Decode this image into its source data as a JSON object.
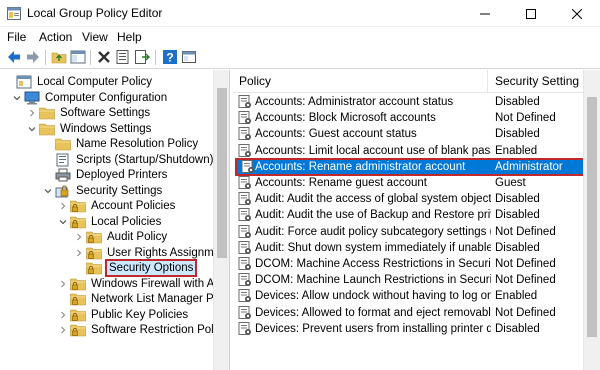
{
  "window": {
    "title": "Local Group Policy Editor"
  },
  "menu": [
    "File",
    "Action",
    "View",
    "Help"
  ],
  "toolbar_icons": [
    "back-arrow-icon",
    "forward-arrow-icon",
    "up-folder-icon",
    "show-hide-tree-icon",
    "delete-icon",
    "properties-icon",
    "export-list-icon",
    "help-icon",
    "console-icon"
  ],
  "tree": [
    {
      "label": "Local Computer Policy",
      "icon": "computer-policy-icon",
      "expander": ""
    },
    {
      "label": "Computer Configuration",
      "icon": "computer-icon",
      "expander": "down"
    },
    {
      "label": "Software Settings",
      "icon": "folder-icon",
      "expander": "right"
    },
    {
      "label": "Windows Settings",
      "icon": "folder-icon",
      "expander": "down"
    },
    {
      "label": "Name Resolution Policy",
      "icon": "folder-icon",
      "expander": ""
    },
    {
      "label": "Scripts (Startup/Shutdown)",
      "icon": "scripts-icon",
      "expander": ""
    },
    {
      "label": "Deployed Printers",
      "icon": "printer-icon",
      "expander": ""
    },
    {
      "label": "Security Settings",
      "icon": "security-settings-icon",
      "expander": "down"
    },
    {
      "label": "Account Policies",
      "icon": "folder-lock-icon",
      "expander": "right"
    },
    {
      "label": "Local Policies",
      "icon": "folder-lock-icon",
      "expander": "down"
    },
    {
      "label": "Audit Policy",
      "icon": "folder-lock-icon",
      "expander": "right"
    },
    {
      "label": "User Rights Assignment",
      "icon": "folder-lock-icon",
      "expander": "right"
    },
    {
      "label": "Security Options",
      "icon": "folder-lock-icon",
      "expander": ""
    },
    {
      "label": "Windows Firewall with Adva",
      "icon": "folder-lock-icon",
      "expander": "right"
    },
    {
      "label": "Network List Manager Polici",
      "icon": "folder-lock-icon",
      "expander": ""
    },
    {
      "label": "Public Key Policies",
      "icon": "folder-lock-icon",
      "expander": "right"
    },
    {
      "label": "Software Restriction Policies",
      "icon": "folder-lock-icon",
      "expander": "right"
    }
  ],
  "columns": {
    "policy": "Policy",
    "setting": "Security Setting"
  },
  "rows": [
    {
      "policy": "Accounts: Administrator account status",
      "setting": "Disabled"
    },
    {
      "policy": "Accounts: Block Microsoft accounts",
      "setting": "Not Defined"
    },
    {
      "policy": "Accounts: Guest account status",
      "setting": "Disabled"
    },
    {
      "policy": "Accounts: Limit local account use of blank passwo...",
      "setting": "Enabled"
    },
    {
      "policy": "Accounts: Rename administrator account",
      "setting": "Administrator"
    },
    {
      "policy": "Accounts: Rename guest account",
      "setting": "Guest"
    },
    {
      "policy": "Audit: Audit the access of global system objects",
      "setting": "Disabled"
    },
    {
      "policy": "Audit: Audit the use of Backup and Restore privilege",
      "setting": "Disabled"
    },
    {
      "policy": "Audit: Force audit policy subcategory settings (Wi...",
      "setting": "Not Defined"
    },
    {
      "policy": "Audit: Shut down system immediately if unable to ...",
      "setting": "Disabled"
    },
    {
      "policy": "DCOM: Machine Access Restrictions in Security De...",
      "setting": "Not Defined"
    },
    {
      "policy": "DCOM: Machine Launch Restrictions in Security De...",
      "setting": "Not Defined"
    },
    {
      "policy": "Devices: Allow undock without having to log on",
      "setting": "Enabled"
    },
    {
      "policy": "Devices: Allowed to format and eject removable m...",
      "setting": "Not Defined"
    },
    {
      "policy": "Devices: Prevent users from installing printer drivers",
      "setting": "Disabled"
    }
  ],
  "state": {
    "selected_tree_item": "Security Options",
    "selected_row": "Accounts: Rename administrator account"
  },
  "colors": {
    "selection": "#0078d7",
    "highlight_outline": "#c0282b",
    "folder": "#e8c25a"
  }
}
